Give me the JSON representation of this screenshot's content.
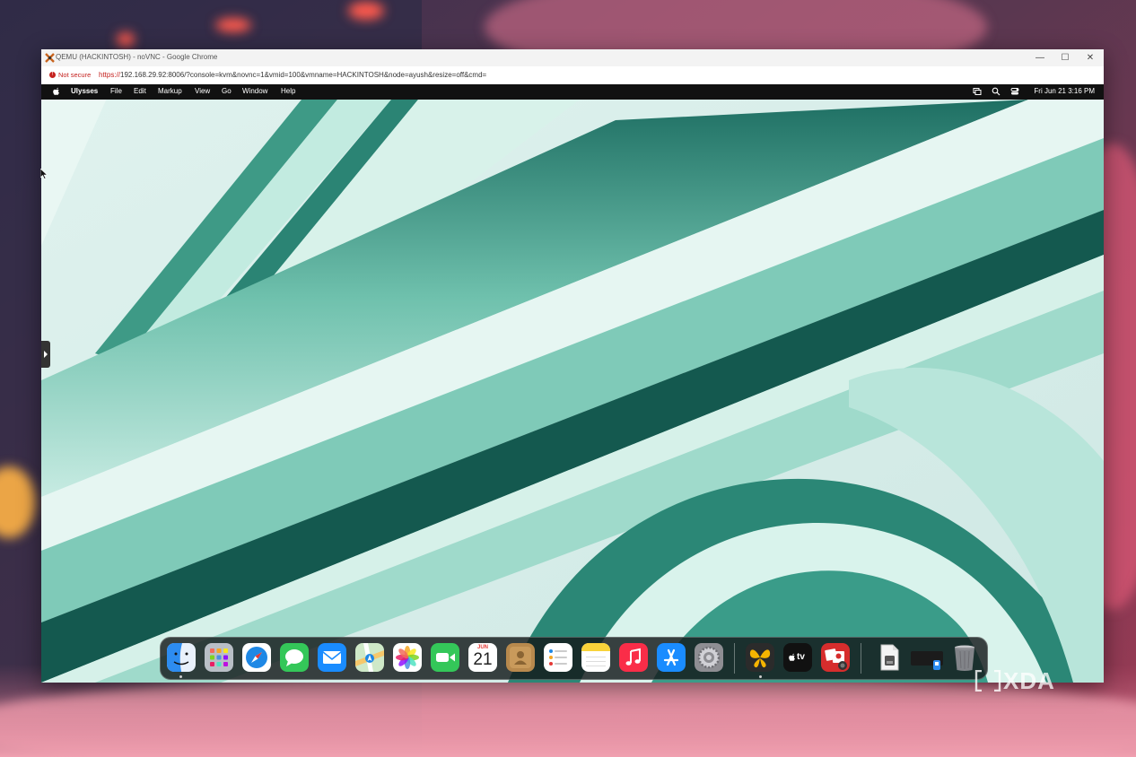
{
  "browser": {
    "window_title": "QEMU (HACKINTOSH) - noVNC - Google Chrome",
    "controls": {
      "minimize": "—",
      "maximize": "☐",
      "close": "✕"
    },
    "security_label": "Not secure",
    "url_protocol": "https://",
    "url_rest": "192.168.29.92:8006/?console=kvm&novnc=1&vmid=100&vmname=HACKINTOSH&node=ayush&resize=off&cmd="
  },
  "menubar": {
    "app_name": "Ulysses",
    "items": [
      "File",
      "Edit",
      "Markup",
      "View",
      "Go",
      "Window",
      "Help"
    ],
    "clock": "Fri Jun 21  3:16 PM"
  },
  "dock": {
    "apps": [
      {
        "name": "Finder"
      },
      {
        "name": "Launchpad"
      },
      {
        "name": "Safari"
      },
      {
        "name": "Messages"
      },
      {
        "name": "Mail"
      },
      {
        "name": "Maps"
      },
      {
        "name": "Photos"
      },
      {
        "name": "FaceTime"
      },
      {
        "name": "Calendar",
        "month": "JUN",
        "day": "21"
      },
      {
        "name": "Contacts"
      },
      {
        "name": "Reminders"
      },
      {
        "name": "Notes"
      },
      {
        "name": "Music"
      },
      {
        "name": "App Store"
      },
      {
        "name": "System Settings"
      },
      {
        "name": "Ulysses"
      },
      {
        "name": "Apple TV",
        "label": "tv"
      },
      {
        "name": "Photo Booth"
      },
      {
        "name": "Document"
      },
      {
        "name": "Downloads"
      },
      {
        "name": "Trash"
      }
    ]
  },
  "watermark": "XDA",
  "colors": {
    "menubar": "#111111",
    "insecure": "#c5221f",
    "wallpaper_teal": "#2f8f7d"
  }
}
